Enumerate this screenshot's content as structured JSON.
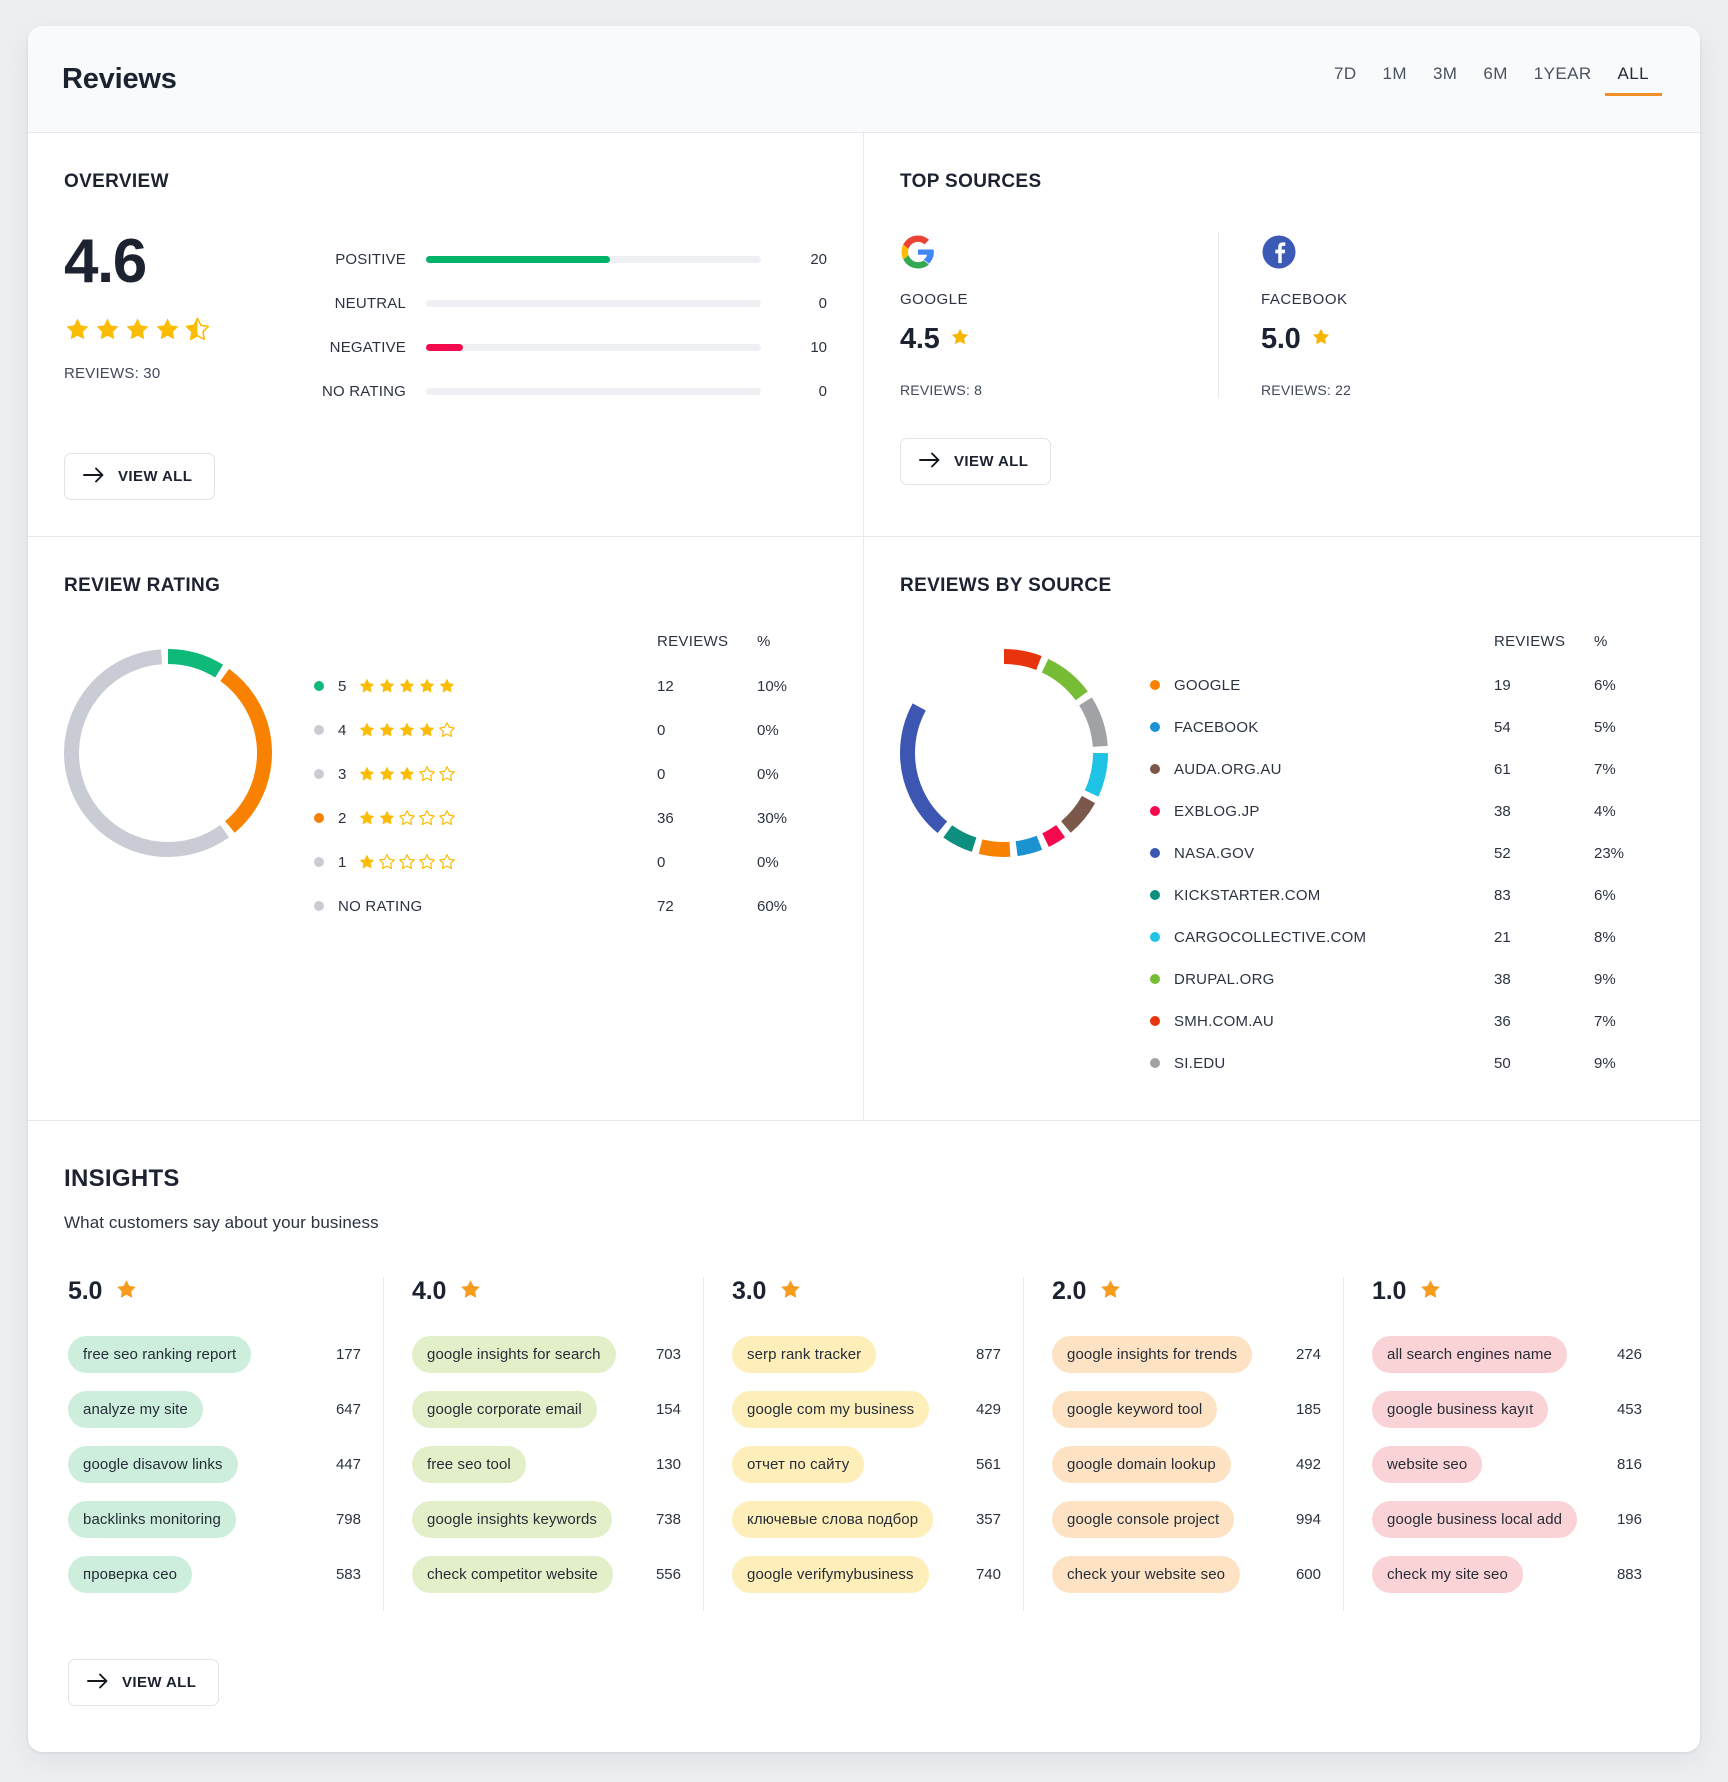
{
  "header": {
    "title": "Reviews",
    "ranges": [
      {
        "label": "7D",
        "active": false
      },
      {
        "label": "1M",
        "active": false
      },
      {
        "label": "3M",
        "active": false
      },
      {
        "label": "6M",
        "active": false
      },
      {
        "label": "1YEAR",
        "active": false
      },
      {
        "label": "ALL",
        "active": true
      }
    ],
    "accent_color": "#f29028"
  },
  "overview": {
    "title": "OVERVIEW",
    "score": "4.6",
    "stars": 4.5,
    "reviews_label": "REVIEWS: 30",
    "view_all_label": "VIEW ALL",
    "sentiments": [
      {
        "label": "POSITIVE",
        "value": "20",
        "pct": 55,
        "color": "#00b368"
      },
      {
        "label": "NEUTRAL",
        "value": "0",
        "pct": 0,
        "color": "#00b368"
      },
      {
        "label": "NEGATIVE",
        "value": "10",
        "pct": 11,
        "color": "#f50a4d"
      },
      {
        "label": "NO RATING",
        "value": "0",
        "pct": 0,
        "color": "#c9ccd4"
      }
    ]
  },
  "top_sources": {
    "title": "TOP SOURCES",
    "view_all_label": "VIEW ALL",
    "items": [
      {
        "icon": "google-logo-icon",
        "name": "GOOGLE",
        "rating": "4.5",
        "reviews_label": "REVIEWS: 8"
      },
      {
        "icon": "facebook-logo-icon",
        "name": "FACEBOOK",
        "rating": "5.0",
        "reviews_label": "REVIEWS: 22"
      }
    ]
  },
  "review_rating": {
    "title": "REVIEW RATING",
    "columns": {
      "reviews": "REVIEWS",
      "pct": "%"
    },
    "rows": [
      {
        "label": "5",
        "stars": 5,
        "reviews": "12",
        "pct": "10%",
        "color": "#0fb97a",
        "share": 10
      },
      {
        "label": "4",
        "stars": 4,
        "reviews": "0",
        "pct": "0%",
        "color": "#c9ccd4",
        "share": 0
      },
      {
        "label": "3",
        "stars": 3,
        "reviews": "0",
        "pct": "0%",
        "color": "#c9ccd4",
        "share": 0
      },
      {
        "label": "2",
        "stars": 2,
        "reviews": "36",
        "pct": "30%",
        "color": "#f98100",
        "share": 30
      },
      {
        "label": "1",
        "stars": 1,
        "reviews": "0",
        "pct": "0%",
        "color": "#c9ccd4",
        "share": 0
      },
      {
        "label": "NO RATING",
        "stars": 0,
        "reviews": "72",
        "pct": "60%",
        "color": "#c9ccd4",
        "share": 60
      }
    ]
  },
  "reviews_by_source": {
    "title": "REVIEWS BY SOURCE",
    "columns": {
      "reviews": "REVIEWS",
      "pct": "%"
    },
    "rows": [
      {
        "name": "GOOGLE",
        "reviews": "19",
        "pct": "6%",
        "color": "#f98100"
      },
      {
        "name": "FACEBOOK",
        "reviews": "54",
        "pct": "5%",
        "color": "#1b92d1"
      },
      {
        "name": "AUDA.ORG.AU",
        "reviews": "61",
        "pct": "7%",
        "color": "#7c584a"
      },
      {
        "name": "EXBLOG.JP",
        "reviews": "38",
        "pct": "4%",
        "color": "#f50a4d"
      },
      {
        "name": "NASA.GOV",
        "reviews": "52",
        "pct": "23%",
        "color": "#3d56b2"
      },
      {
        "name": "KICKSTARTER.COM",
        "reviews": "83",
        "pct": "6%",
        "color": "#0c8f7f"
      },
      {
        "name": "CARGOCOLLECTIVE.COM",
        "reviews": "21",
        "pct": "8%",
        "color": "#1ec3e6"
      },
      {
        "name": "DRUPAL.ORG",
        "reviews": "38",
        "pct": "9%",
        "color": "#76bc34"
      },
      {
        "name": "SMH.COM.AU",
        "reviews": "36",
        "pct": "7%",
        "color": "#e8340c"
      },
      {
        "name": "SI.EDU",
        "reviews": "50",
        "pct": "9%",
        "color": "#a0a2a6"
      }
    ]
  },
  "insights": {
    "title": "INSIGHTS",
    "subtitle": "What customers say about your business",
    "view_all_label": "VIEW ALL",
    "columns": [
      {
        "score": "5.0",
        "pill_color": "#cdeedd",
        "keywords": [
          {
            "text": "free seo ranking report",
            "count": "177"
          },
          {
            "text": "analyze my site",
            "count": "647"
          },
          {
            "text": "google disavow links",
            "count": "447"
          },
          {
            "text": "backlinks monitoring",
            "count": "798"
          },
          {
            "text": "проверка сео",
            "count": "583"
          }
        ]
      },
      {
        "score": "4.0",
        "pill_color": "#e3efc9",
        "keywords": [
          {
            "text": "google insights for search",
            "count": "703"
          },
          {
            "text": "google corporate email",
            "count": "154"
          },
          {
            "text": "free seo tool",
            "count": "130"
          },
          {
            "text": "google insights keywords",
            "count": "738"
          },
          {
            "text": "check competitor website",
            "count": "556"
          }
        ]
      },
      {
        "score": "3.0",
        "pill_color": "#fdeeba",
        "keywords": [
          {
            "text": "serp rank tracker",
            "count": "877"
          },
          {
            "text": "google com my business",
            "count": "429"
          },
          {
            "text": "отчет по сайту",
            "count": "561"
          },
          {
            "text": "ключевые слова подбор",
            "count": "357"
          },
          {
            "text": "google verifymybusiness",
            "count": "740"
          }
        ]
      },
      {
        "score": "2.0",
        "pill_color": "#fde2c4",
        "keywords": [
          {
            "text": "google insights for trends",
            "count": "274"
          },
          {
            "text": "google keyword tool",
            "count": "185"
          },
          {
            "text": "google domain lookup",
            "count": "492"
          },
          {
            "text": "google console project",
            "count": "994"
          },
          {
            "text": "check your website seo",
            "count": "600"
          }
        ]
      },
      {
        "score": "1.0",
        "pill_color": "#fad3d6",
        "keywords": [
          {
            "text": "all search engines name",
            "count": "426"
          },
          {
            "text": "google business kayıt",
            "count": "453"
          },
          {
            "text": "website seo",
            "count": "816"
          },
          {
            "text": "google business local add",
            "count": "196"
          },
          {
            "text": "check my site seo",
            "count": "883"
          }
        ]
      }
    ]
  },
  "chart_data": [
    {
      "type": "pie",
      "title": "REVIEW RATING",
      "categories": [
        "5",
        "4",
        "3",
        "2",
        "1",
        "NO RATING"
      ],
      "values": [
        12,
        0,
        0,
        36,
        0,
        72
      ],
      "percentages": [
        10,
        0,
        0,
        30,
        0,
        60
      ],
      "colors": [
        "#0fb97a",
        "#c9ccd4",
        "#c9ccd4",
        "#f98100",
        "#c9ccd4",
        "#c9ccd4"
      ],
      "legend": "right"
    },
    {
      "type": "pie",
      "title": "REVIEWS BY SOURCE",
      "categories": [
        "GOOGLE",
        "FACEBOOK",
        "AUDA.ORG.AU",
        "EXBLOG.JP",
        "NASA.GOV",
        "KICKSTARTER.COM",
        "CARGOCOLLECTIVE.COM",
        "DRUPAL.ORG",
        "SMH.COM.AU",
        "SI.EDU"
      ],
      "values": [
        19,
        54,
        61,
        38,
        52,
        83,
        21,
        38,
        36,
        50
      ],
      "percentages": [
        6,
        5,
        7,
        4,
        23,
        6,
        8,
        9,
        7,
        9
      ],
      "colors": [
        "#f98100",
        "#1b92d1",
        "#7c584a",
        "#f50a4d",
        "#3d56b2",
        "#0c8f7f",
        "#1ec3e6",
        "#76bc34",
        "#e8340c",
        "#a0a2a6"
      ],
      "legend": "right"
    },
    {
      "type": "bar",
      "title": "OVERVIEW sentiment",
      "categories": [
        "POSITIVE",
        "NEUTRAL",
        "NEGATIVE",
        "NO RATING"
      ],
      "values": [
        20,
        0,
        10,
        0
      ],
      "colors": [
        "#00b368",
        "#00b368",
        "#f50a4d",
        "#c9ccd4"
      ],
      "xlabel": "",
      "ylabel": ""
    }
  ]
}
